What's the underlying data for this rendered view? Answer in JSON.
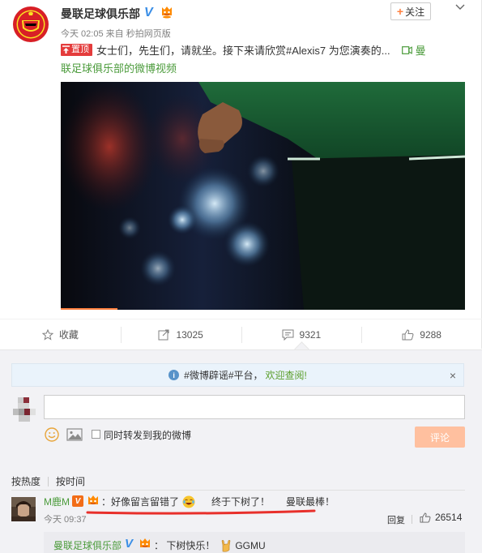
{
  "post": {
    "author": "曼联足球俱乐部",
    "verified_mark": "V",
    "follow_label": "关注",
    "follow_plus": "+",
    "time": "今天 02:05",
    "source": "来自 秒拍网页版",
    "pin_label": "置顶",
    "text": "女士们，先生们，请就坐。接下来请欣赏#Alexis7 为您演奏的...",
    "video_link_line1": "曼",
    "video_link_line2": "联足球俱乐部的微博视频",
    "video_progress": 0.14,
    "icons": [
      "more-chevron-icon",
      "member-badge-icon",
      "pin-icon",
      "video-icon"
    ]
  },
  "actions": {
    "favorite_label": "收藏",
    "repost_count": "13025",
    "comment_count": "9321",
    "like_count": "9288"
  },
  "comments_panel": {
    "notice_tag": "#微博辟谣#平台，",
    "notice_welcome": "欢迎查阅!",
    "notice_close": "×",
    "input_value": "",
    "repost_label": "同时转发到我的微博",
    "submit_label": "评论",
    "sort_hot": "按热度",
    "sort_time": "按时间"
  },
  "comment": {
    "user": "M鹿M",
    "vip_mark": "V",
    "colon": "：",
    "part1": "好像留言留错了",
    "part2": "终于下树了！",
    "part3": "曼联最棒！",
    "time": "今天 09:37",
    "reply_label": "回复",
    "like_count": "26514",
    "highlight_color": "#e8302b"
  },
  "sub_reply": {
    "user": "曼联足球俱乐部",
    "verified_mark": "V",
    "text_before": "：  下树快乐！",
    "text_after": "GGMU"
  },
  "colors": {
    "accent_orange": "#ff8140",
    "link_green": "#4b9b3b",
    "verified_blue": "#3a8ee6",
    "pin_red": "#e43c3c",
    "submit_disabled": "#ffc09f"
  }
}
